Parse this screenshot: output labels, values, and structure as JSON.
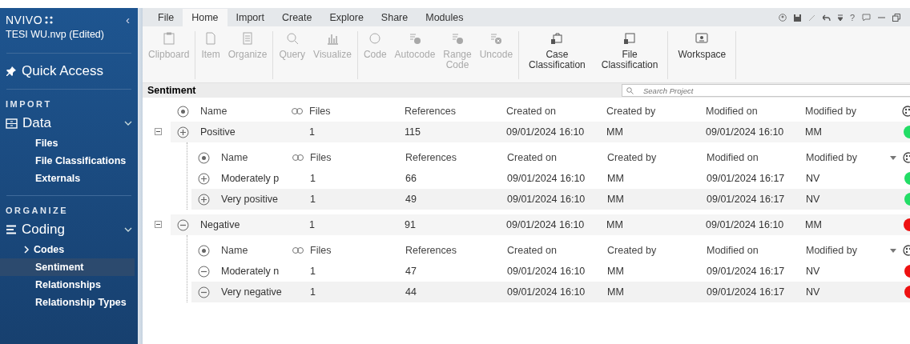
{
  "sidebar": {
    "logo": "NVIVO",
    "project": "TESI WU.nvp (Edited)",
    "collapse": "‹",
    "quick_access": "Quick Access",
    "sections": [
      {
        "heading": "IMPORT",
        "group": {
          "label": "Data",
          "kind": "data",
          "expanded": true,
          "items": [
            {
              "label": "Files",
              "kind": "item",
              "selected": false
            },
            {
              "label": "File Classifications",
              "kind": "item",
              "selected": false
            },
            {
              "label": "Externals",
              "kind": "item",
              "selected": false
            }
          ]
        }
      },
      {
        "heading": "ORGANIZE",
        "group": {
          "label": "Coding",
          "kind": "coding",
          "expanded": true,
          "items": [
            {
              "label": "Codes",
              "kind": "folder",
              "expanded": false,
              "selected": false
            },
            {
              "label": "Sentiment",
              "kind": "item",
              "selected": true
            },
            {
              "label": "Relationships",
              "kind": "item",
              "selected": false
            },
            {
              "label": "Relationship Types",
              "kind": "item",
              "selected": false
            }
          ]
        }
      }
    ]
  },
  "ribbon": {
    "tabs": [
      {
        "label": "File",
        "selected": false
      },
      {
        "label": "Home",
        "selected": true
      },
      {
        "label": "Import",
        "selected": false
      },
      {
        "label": "Create",
        "selected": false
      },
      {
        "label": "Explore",
        "selected": false
      },
      {
        "label": "Share",
        "selected": false
      },
      {
        "label": "Modules",
        "selected": false
      }
    ],
    "help": "?",
    "groups": [
      [
        {
          "label": "Clipboard",
          "disabled": true
        }
      ],
      [
        {
          "label": "Item",
          "disabled": true
        },
        {
          "label": "Organize",
          "disabled": true
        }
      ],
      [
        {
          "label": "Query",
          "disabled": true
        },
        {
          "label": "Visualize",
          "disabled": true
        }
      ],
      [
        {
          "label": "Code",
          "disabled": true
        },
        {
          "label": "Autocode",
          "disabled": true
        },
        {
          "label": "Range Code",
          "disabled": true
        },
        {
          "label": "Uncode",
          "disabled": true
        }
      ],
      [
        {
          "label": "Case Classification",
          "disabled": false
        },
        {
          "label": "File Classification",
          "disabled": false
        }
      ],
      [
        {
          "label": "Workspace",
          "disabled": false
        }
      ]
    ]
  },
  "view": {
    "title": "Sentiment",
    "search": {
      "placeholder": "Search Project"
    },
    "columns": [
      "Name",
      "Files",
      "References",
      "Created on",
      "Created by",
      "Modified on",
      "Modified by"
    ],
    "rows": [
      {
        "name": "Positive",
        "kind": "positive",
        "expanded": true,
        "files": "1",
        "references": "115",
        "created_on": "09/01/2024 16:10",
        "created_by": "MM",
        "modified_on": "09/01/2024 16:10",
        "modified_by": "MM",
        "color": "#22dd66",
        "child_columns": [
          "Name",
          "Files",
          "References",
          "Created on",
          "Created by",
          "Modified on",
          "Modified by"
        ],
        "children": [
          {
            "name": "Moderately p",
            "kind": "positive",
            "files": "1",
            "references": "66",
            "created_on": "09/01/2024 16:10",
            "created_by": "MM",
            "modified_on": "09/01/2024 16:17",
            "modified_by": "NV",
            "color": "#22dd66"
          },
          {
            "name": "Very positive",
            "kind": "positive",
            "files": "1",
            "references": "49",
            "created_on": "09/01/2024 16:10",
            "created_by": "MM",
            "modified_on": "09/01/2024 16:17",
            "modified_by": "NV",
            "color": "#22dd66"
          }
        ]
      },
      {
        "name": "Negative",
        "kind": "negative",
        "expanded": true,
        "files": "1",
        "references": "91",
        "created_on": "09/01/2024 16:10",
        "created_by": "MM",
        "modified_on": "09/01/2024 16:10",
        "modified_by": "MM",
        "color": "#ee1111",
        "child_columns": [
          "Name",
          "Files",
          "References",
          "Created on",
          "Created by",
          "Modified on",
          "Modified by"
        ],
        "children": [
          {
            "name": "Moderately n",
            "kind": "negative",
            "files": "1",
            "references": "47",
            "created_on": "09/01/2024 16:10",
            "created_by": "MM",
            "modified_on": "09/01/2024 16:17",
            "modified_by": "NV",
            "color": "#ee1111"
          },
          {
            "name": "Very negative",
            "kind": "negative",
            "files": "1",
            "references": "44",
            "created_on": "09/01/2024 16:10",
            "created_by": "MM",
            "modified_on": "09/01/2024 16:17",
            "modified_by": "NV",
            "color": "#ee1111"
          }
        ]
      }
    ]
  }
}
